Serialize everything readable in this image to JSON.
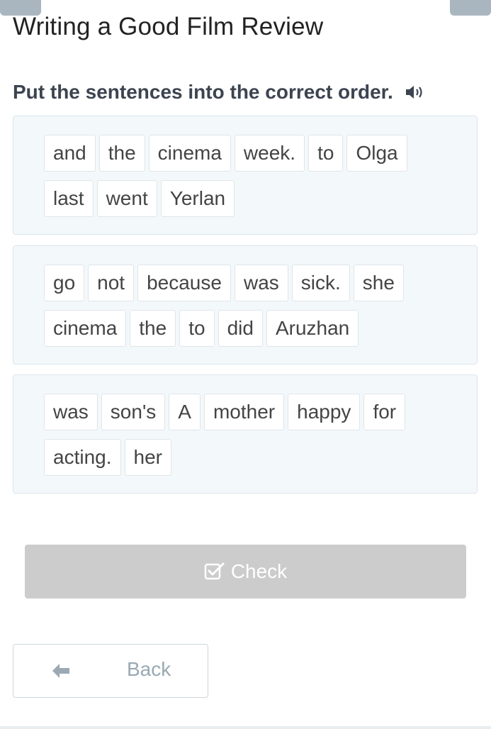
{
  "page": {
    "title": "Writing a Good Film Review",
    "instruction": "Put the sentences into the correct order.",
    "speaker_icon": "speaker-volume-icon"
  },
  "sentences": [
    {
      "row1": [
        "and",
        "the",
        "cinema",
        "week.",
        "to",
        "Olga"
      ],
      "row2": [
        "last",
        "went",
        "Yerlan"
      ]
    },
    {
      "row1": [
        "go",
        "not",
        "because",
        "was",
        "sick.",
        "she"
      ],
      "row2": [
        "cinema",
        "the",
        "to",
        "did",
        "Aruzhan"
      ]
    },
    {
      "row1": [
        "was",
        "son's",
        "A",
        "mother",
        "happy",
        "for"
      ],
      "row2": [
        "acting.",
        "her"
      ]
    }
  ],
  "actions": {
    "check_label": "Check",
    "check_icon": "checkbox-check-icon",
    "back_label": "Back",
    "back_icon": "arrow-left-icon"
  },
  "colors": {
    "panel_bg": "#f3f8fb",
    "check_disabled_bg": "#cccccc",
    "back_text": "#9aa9b3"
  }
}
